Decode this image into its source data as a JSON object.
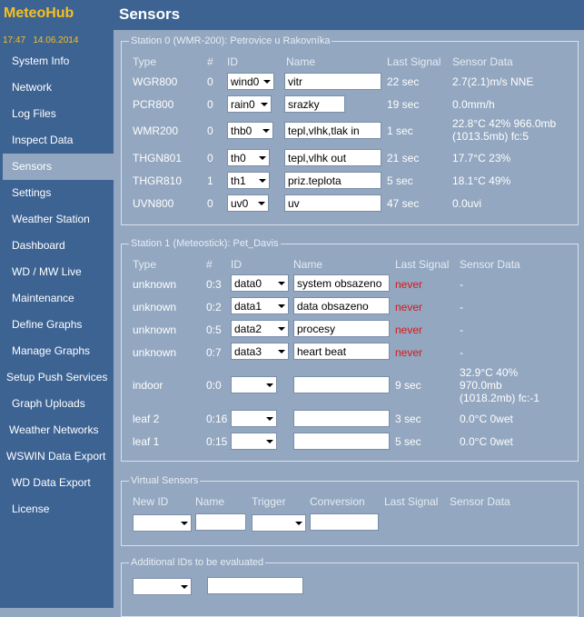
{
  "app": {
    "brand": "MeteoHub",
    "time": "17:47",
    "date": "14.06.2014"
  },
  "nav": [
    "System Info",
    "Network",
    "Log Files",
    "Inspect Data",
    "Sensors",
    "Settings",
    "Weather Station",
    "Dashboard",
    "WD / MW Live",
    "Maintenance",
    "Define Graphs",
    "Manage Graphs",
    "Setup Push Services",
    "Graph Uploads",
    "Weather Networks",
    "WSWIN Data Export",
    "WD Data Export",
    "License"
  ],
  "page": {
    "title": "Sensors"
  },
  "station0": {
    "legend": "Station 0 (WMR-200): Petrovice u Rakovníka",
    "headers": {
      "type": "Type",
      "num": "#",
      "id": "ID",
      "name": "Name",
      "last": "Last Signal",
      "data": "Sensor Data"
    },
    "rows": [
      {
        "type": "WGR800",
        "num": "0",
        "id": "wind0",
        "name": "vitr",
        "last": "22 sec",
        "data": "2.7(2.1)m/s NNE"
      },
      {
        "type": "PCR800",
        "num": "0",
        "id": "rain0",
        "name": "srazky",
        "last": "19 sec",
        "data": "0.0mm/h"
      },
      {
        "type": "WMR200",
        "num": "0",
        "id": "thb0",
        "name": "tepl,vlhk,tlak in",
        "last": "1 sec",
        "data": "22.8°C 42% 966.0mb (1013.5mb) fc:5"
      },
      {
        "type": "THGN801",
        "num": "0",
        "id": "th0",
        "name": "tepl,vlhk out",
        "last": "21 sec",
        "data": "17.7°C 23%"
      },
      {
        "type": "THGR810",
        "num": "1",
        "id": "th1",
        "name": "priz.teplota",
        "last": "5 sec",
        "data": "18.1°C 49%"
      },
      {
        "type": "UVN800",
        "num": "0",
        "id": "uv0",
        "name": "uv",
        "last": "47 sec",
        "data": "0.0uvi"
      }
    ]
  },
  "station1": {
    "legend": "Station 1 (Meteostick): Pet_Davis",
    "headers": {
      "type": "Type",
      "num": "#",
      "id": "ID",
      "name": "Name",
      "last": "Last Signal",
      "data": "Sensor Data"
    },
    "rows": [
      {
        "type": "unknown",
        "num": "0:3",
        "id": "data0",
        "name": "system obsazeno",
        "last": "never",
        "data": "-"
      },
      {
        "type": "unknown",
        "num": "0:2",
        "id": "data1",
        "name": "data obsazeno",
        "last": "never",
        "data": "-"
      },
      {
        "type": "unknown",
        "num": "0:5",
        "id": "data2",
        "name": "procesy",
        "last": "never",
        "data": "-"
      },
      {
        "type": "unknown",
        "num": "0:7",
        "id": "data3",
        "name": "heart beat",
        "last": "never",
        "data": "-"
      },
      {
        "type": "indoor",
        "num": "0:0",
        "id": "",
        "name": "",
        "last": "9 sec",
        "data": "32.9°C 40% 970.0mb (1018.2mb) fc:-1"
      },
      {
        "type": "leaf 2",
        "num": "0:16",
        "id": "",
        "name": "",
        "last": "3 sec",
        "data": "0.0°C 0wet"
      },
      {
        "type": "leaf 1",
        "num": "0:15",
        "id": "",
        "name": "",
        "last": "5 sec",
        "data": "0.0°C 0wet"
      }
    ]
  },
  "virtual": {
    "legend": "Virtual Sensors",
    "headers": {
      "new_id": "New ID",
      "name": "Name",
      "trigger": "Trigger",
      "conversion": "Conversion",
      "last": "Last Signal",
      "data": "Sensor Data"
    }
  },
  "additional": {
    "legend": "Additional IDs to be evaluated"
  },
  "colors": {
    "sidebar": "#3d6393",
    "content": "#93a7c0",
    "brand": "#f5c020",
    "never": "#d61a1a"
  }
}
